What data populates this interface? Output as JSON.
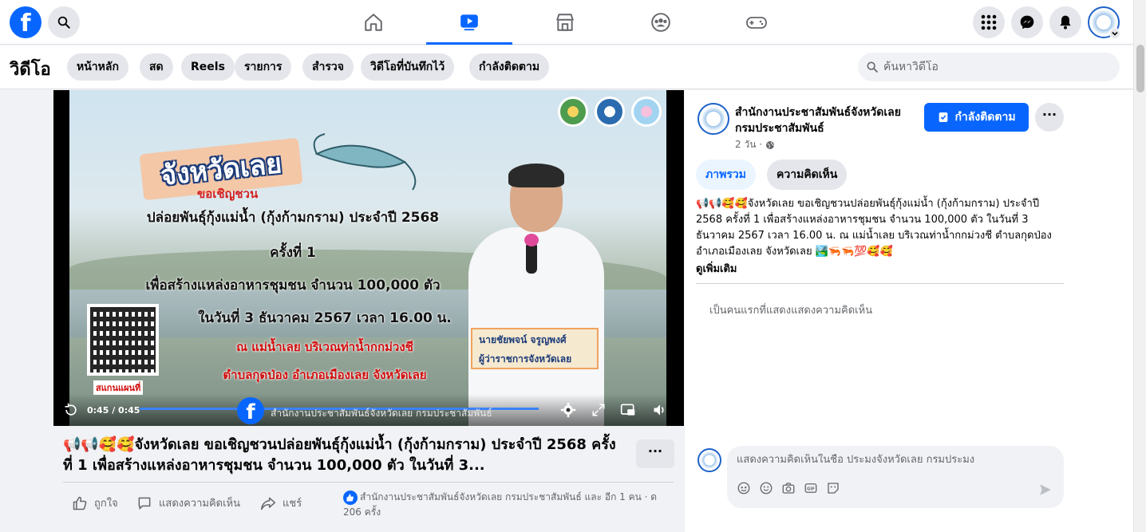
{
  "topbar": {
    "logo": "f",
    "nav": [
      {
        "icon": "home-icon"
      },
      {
        "icon": "video-icon",
        "active": true
      },
      {
        "icon": "marketplace-icon"
      },
      {
        "icon": "groups-icon"
      },
      {
        "icon": "gaming-icon"
      }
    ],
    "right_icons": [
      "menu-grid-icon",
      "messenger-icon",
      "notifications-icon",
      "profile-avatar"
    ],
    "accent": "#0866ff"
  },
  "subbar": {
    "title": "วิดีโอ",
    "pills": [
      "หน้าหลัก",
      "สด",
      "Reels",
      "รายการ",
      "สำรวจ",
      "วิดีโอที่บันทึกไว้",
      "กำลังติดตาม"
    ],
    "search_placeholder": "ค้นหาวิดีโอ"
  },
  "video": {
    "province": "จังหวัดเลย",
    "invite": "ขอเชิญชวน",
    "line1": "ปล่อยพันธุ์กุ้งแม่น้ำ (กุ้งก้ามกราม) ประจำปี 2568",
    "line2": "ครั้งที่ 1",
    "line3": "เพื่อสร้างแหล่งอาหารชุมชน จำนวน 100,000 ตัว",
    "line4": "ในวันที่ 3 ธันวาคม 2567 เวลา 16.00 น.",
    "line5": "ณ แม่น้ำเลย บริเวณท่าน้ำกกม่วงชี",
    "line6": "ตำบลกุดป่อง อำเภอเมืองเลย จังหวัดเลย",
    "qr_caption": "สแกนแผนที่",
    "name_line1": "นายชัยพจน์ จรูญพงศ์",
    "name_line2": "ผู้ว่าราชการจังหวัดเลย",
    "time": "0:45 / 0:45",
    "progress": 1.0,
    "channel_overlay": "สำนักงานประชาสัมพันธ์จังหวัดเลย กรมประชาสัมพันธ์"
  },
  "post": {
    "title": "📢📢🥰🥰จังหวัดเลย ขอเชิญชวนปล่อยพันธุ์กุ้งแม่น้ำ (กุ้งก้ามกราม) ประจำปี 2568 ครั้งที่ 1 เพื่อสร้างแหล่งอาหารชุมชน จำนวน 100,000 ตัว ในวันที่ 3...",
    "more": "···",
    "like": "ถูกใจ",
    "comment": "แสดงความคิดเห็น",
    "share": "แชร์",
    "reactions": "สำนักงานประชาสัมพันธ์จังหวัดเลย กรมประชาสัมพันธ์ และ อีก 1 คน · ด 206 ครั้ง"
  },
  "panel": {
    "page_name": "สำนักงานประชาสัมพันธ์จังหวัดเลย กรมประชาสัมพันธ์",
    "page_meta": "2 วัน · ",
    "follow": "กำลังติดตาม",
    "more": "···",
    "tab_overview": "ภาพรวม",
    "tab_comments": "ความคิดเห็น",
    "description": "📢📢🥰🥰จังหวัดเลย ขอเชิญชวนปล่อยพันธุ์กุ้งแม่น้ำ (กุ้งก้ามกราม) ประจำปี 2568 ครั้งที่ 1 เพื่อสร้างแหล่งอาหารชุมชน จำนวน 100,000 ตัว ในวันที่ 3 ธันวาคม 2567 เวลา 16.00 น. ณ แม่น้ำเลย บริเวณท่าน้ำกกม่วงชี ตำบลกุดป่อง อำเภอเมืองเลย จังหวัดเลย 🏞️🦐🦐💯🥰🥰",
    "see_more": "ดูเพิ่มเติม",
    "first_comment": "เป็นคนแรกที่แสดงแสดงความคิดเห็น",
    "comment_placeholder": "แสดงความคิดเห็นในชื่อ ประมงจังหวัดเลย กรมประมง"
  }
}
